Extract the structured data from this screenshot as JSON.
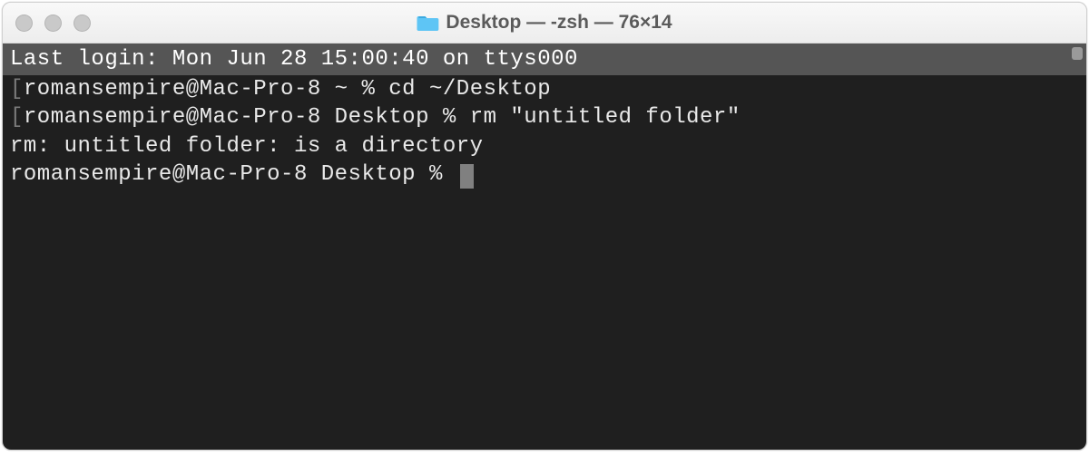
{
  "window": {
    "title": "Desktop — -zsh — 76×14"
  },
  "terminal": {
    "login_line": "Last login: Mon Jun 28 15:00:40 on ttys000",
    "lines": [
      {
        "prompt": "romansempire@Mac-Pro-8 ~ % ",
        "cmd": "cd ~/Desktop"
      },
      {
        "prompt": "romansempire@Mac-Pro-8 Desktop % ",
        "cmd": "rm \"untitled folder\""
      },
      {
        "text": "rm: untitled folder: is a directory"
      },
      {
        "prompt": "romansempire@Mac-Pro-8 Desktop % ",
        "cursor": true
      }
    ]
  }
}
